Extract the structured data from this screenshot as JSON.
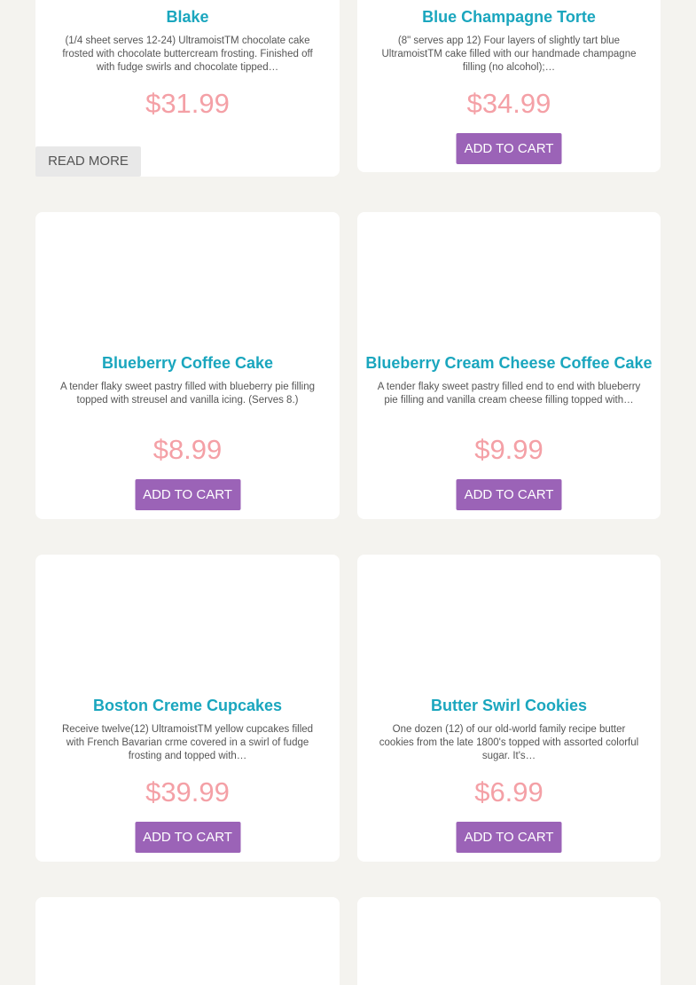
{
  "colors": {
    "page_background": "#f4f3ef",
    "card_background": "#ffffff",
    "title": "#1aa6be",
    "price": "#f4a0a6",
    "add_to_cart_button": "#9b63b7",
    "read_more_button": "#e8e8e8"
  },
  "products": [
    {
      "title": "Blake",
      "description": "(1/4 sheet serves 12-24) UltramoistTM chocolate cake frosted with chocolate buttercream frosting. Finished off with fudge swirls and chocolate tipped…",
      "price": "$31.99",
      "button": "READ MORE"
    },
    {
      "title": "Blue Champagne Torte",
      "description": "(8\" serves app 12) Four layers of slightly tart blue UltramoistTM cake filled with our handmade champagne filling (no alcohol);…",
      "price": "$34.99",
      "button": "ADD TO CART"
    },
    {
      "title": "Blueberry Coffee Cake",
      "description": "A tender flaky sweet pastry filled with blueberry pie filling topped with streusel and vanilla icing. (Serves 8.)",
      "price": "$8.99",
      "button": "ADD TO CART"
    },
    {
      "title": "Blueberry Cream Cheese Coffee Cake",
      "description": "A tender flaky sweet pastry filled end to end with blueberry pie filling and vanilla cream cheese filling topped with…",
      "price": "$9.99",
      "button": "ADD TO CART"
    },
    {
      "title": "Boston Creme Cupcakes",
      "description": "Receive twelve(12) UltramoistTM yellow cupcakes filled with French Bavarian crme covered in a swirl of fudge frosting and topped with…",
      "price": "$39.99",
      "button": "ADD TO CART"
    },
    {
      "title": "Butter Swirl Cookies",
      "description": "One dozen (12) of our old-world family recipe butter cookies from the late 1800's topped with assorted colorful sugar. It's…",
      "price": "$6.99",
      "button": "ADD TO CART"
    }
  ]
}
